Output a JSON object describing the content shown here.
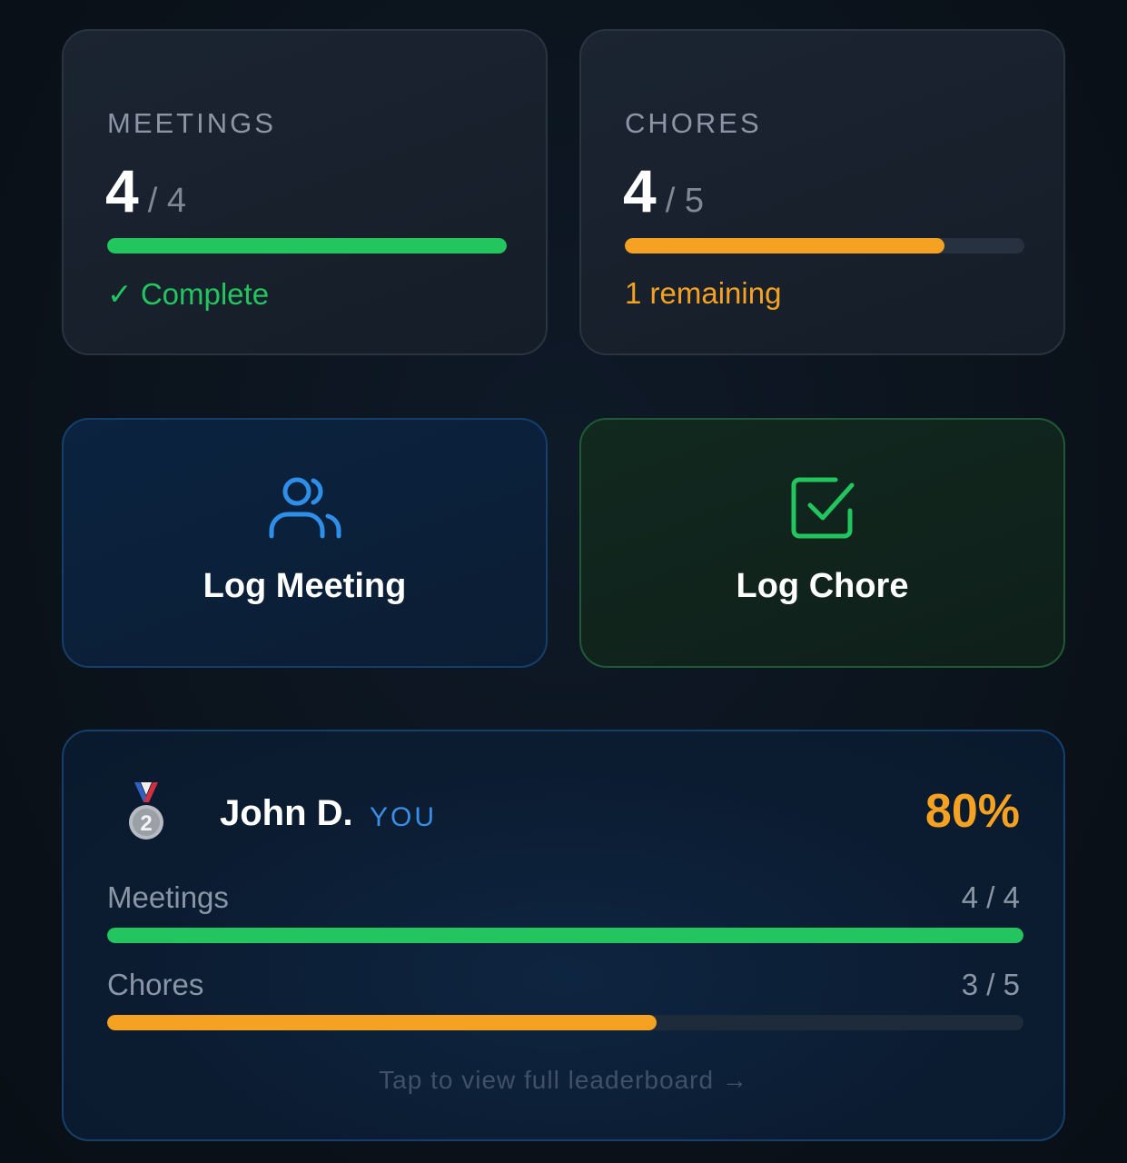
{
  "meetings_card": {
    "label": "MEETINGS",
    "done": "4",
    "total": "/ 4",
    "progress": 1.0,
    "status": "✓ Complete",
    "color": "#22c55e"
  },
  "chores_card": {
    "label": "CHORES",
    "done": "4",
    "total": "/ 5",
    "progress": 0.8,
    "status": "1 remaining",
    "color": "#f5a122"
  },
  "actions": {
    "log_meeting": {
      "label": "Log Meeting",
      "icon": "users-icon",
      "color": "#2f8fe8"
    },
    "log_chore": {
      "label": "Log Chore",
      "icon": "check-square-icon",
      "color": "#22c55e"
    }
  },
  "leaderboard": {
    "medal_icon": "second-place-medal-icon",
    "rank": "2",
    "name": "John D.",
    "you_tag": "YOU",
    "percent": "80%",
    "meetings": {
      "label": "Meetings",
      "value": "4 / 4",
      "progress": 1.0
    },
    "chores": {
      "label": "Chores",
      "value": "3 / 5",
      "progress": 0.6
    },
    "footer": "Tap to view full leaderboard →"
  }
}
